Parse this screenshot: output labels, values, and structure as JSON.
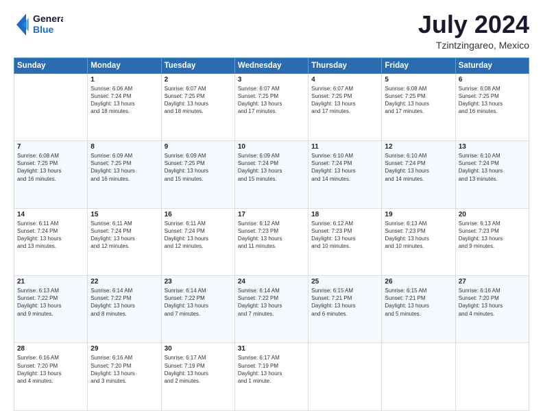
{
  "logo": {
    "line1": "General",
    "line2": "Blue"
  },
  "header": {
    "month": "July 2024",
    "location": "Tzintzingareo, Mexico"
  },
  "weekdays": [
    "Sunday",
    "Monday",
    "Tuesday",
    "Wednesday",
    "Thursday",
    "Friday",
    "Saturday"
  ],
  "weeks": [
    [
      {
        "day": "",
        "info": ""
      },
      {
        "day": "1",
        "info": "Sunrise: 6:06 AM\nSunset: 7:24 PM\nDaylight: 13 hours\nand 18 minutes."
      },
      {
        "day": "2",
        "info": "Sunrise: 6:07 AM\nSunset: 7:25 PM\nDaylight: 13 hours\nand 18 minutes."
      },
      {
        "day": "3",
        "info": "Sunrise: 6:07 AM\nSunset: 7:25 PM\nDaylight: 13 hours\nand 17 minutes."
      },
      {
        "day": "4",
        "info": "Sunrise: 6:07 AM\nSunset: 7:25 PM\nDaylight: 13 hours\nand 17 minutes."
      },
      {
        "day": "5",
        "info": "Sunrise: 6:08 AM\nSunset: 7:25 PM\nDaylight: 13 hours\nand 17 minutes."
      },
      {
        "day": "6",
        "info": "Sunrise: 6:08 AM\nSunset: 7:25 PM\nDaylight: 13 hours\nand 16 minutes."
      }
    ],
    [
      {
        "day": "7",
        "info": "Sunrise: 6:08 AM\nSunset: 7:25 PM\nDaylight: 13 hours\nand 16 minutes."
      },
      {
        "day": "8",
        "info": "Sunrise: 6:09 AM\nSunset: 7:25 PM\nDaylight: 13 hours\nand 16 minutes."
      },
      {
        "day": "9",
        "info": "Sunrise: 6:09 AM\nSunset: 7:25 PM\nDaylight: 13 hours\nand 15 minutes."
      },
      {
        "day": "10",
        "info": "Sunrise: 6:09 AM\nSunset: 7:24 PM\nDaylight: 13 hours\nand 15 minutes."
      },
      {
        "day": "11",
        "info": "Sunrise: 6:10 AM\nSunset: 7:24 PM\nDaylight: 13 hours\nand 14 minutes."
      },
      {
        "day": "12",
        "info": "Sunrise: 6:10 AM\nSunset: 7:24 PM\nDaylight: 13 hours\nand 14 minutes."
      },
      {
        "day": "13",
        "info": "Sunrise: 6:10 AM\nSunset: 7:24 PM\nDaylight: 13 hours\nand 13 minutes."
      }
    ],
    [
      {
        "day": "14",
        "info": "Sunrise: 6:11 AM\nSunset: 7:24 PM\nDaylight: 13 hours\nand 13 minutes."
      },
      {
        "day": "15",
        "info": "Sunrise: 6:11 AM\nSunset: 7:24 PM\nDaylight: 13 hours\nand 12 minutes."
      },
      {
        "day": "16",
        "info": "Sunrise: 6:11 AM\nSunset: 7:24 PM\nDaylight: 13 hours\nand 12 minutes."
      },
      {
        "day": "17",
        "info": "Sunrise: 6:12 AM\nSunset: 7:23 PM\nDaylight: 13 hours\nand 11 minutes."
      },
      {
        "day": "18",
        "info": "Sunrise: 6:12 AM\nSunset: 7:23 PM\nDaylight: 13 hours\nand 10 minutes."
      },
      {
        "day": "19",
        "info": "Sunrise: 6:13 AM\nSunset: 7:23 PM\nDaylight: 13 hours\nand 10 minutes."
      },
      {
        "day": "20",
        "info": "Sunrise: 6:13 AM\nSunset: 7:23 PM\nDaylight: 13 hours\nand 9 minutes."
      }
    ],
    [
      {
        "day": "21",
        "info": "Sunrise: 6:13 AM\nSunset: 7:22 PM\nDaylight: 13 hours\nand 9 minutes."
      },
      {
        "day": "22",
        "info": "Sunrise: 6:14 AM\nSunset: 7:22 PM\nDaylight: 13 hours\nand 8 minutes."
      },
      {
        "day": "23",
        "info": "Sunrise: 6:14 AM\nSunset: 7:22 PM\nDaylight: 13 hours\nand 7 minutes."
      },
      {
        "day": "24",
        "info": "Sunrise: 6:14 AM\nSunset: 7:22 PM\nDaylight: 13 hours\nand 7 minutes."
      },
      {
        "day": "25",
        "info": "Sunrise: 6:15 AM\nSunset: 7:21 PM\nDaylight: 13 hours\nand 6 minutes."
      },
      {
        "day": "26",
        "info": "Sunrise: 6:15 AM\nSunset: 7:21 PM\nDaylight: 13 hours\nand 5 minutes."
      },
      {
        "day": "27",
        "info": "Sunrise: 6:16 AM\nSunset: 7:20 PM\nDaylight: 13 hours\nand 4 minutes."
      }
    ],
    [
      {
        "day": "28",
        "info": "Sunrise: 6:16 AM\nSunset: 7:20 PM\nDaylight: 13 hours\nand 4 minutes."
      },
      {
        "day": "29",
        "info": "Sunrise: 6:16 AM\nSunset: 7:20 PM\nDaylight: 13 hours\nand 3 minutes."
      },
      {
        "day": "30",
        "info": "Sunrise: 6:17 AM\nSunset: 7:19 PM\nDaylight: 13 hours\nand 2 minutes."
      },
      {
        "day": "31",
        "info": "Sunrise: 6:17 AM\nSunset: 7:19 PM\nDaylight: 13 hours\nand 1 minute."
      },
      {
        "day": "",
        "info": ""
      },
      {
        "day": "",
        "info": ""
      },
      {
        "day": "",
        "info": ""
      }
    ]
  ]
}
